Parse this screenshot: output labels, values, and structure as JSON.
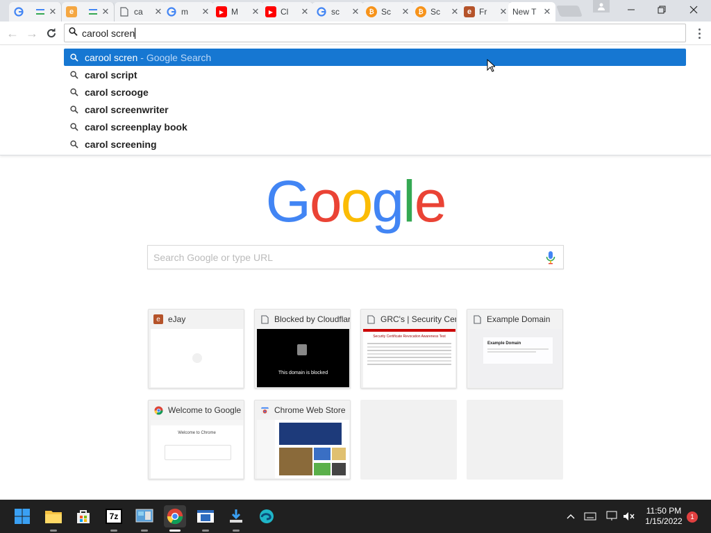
{
  "tabs": [
    {
      "title": "",
      "favicon": "google-icon",
      "close": "✕"
    },
    {
      "title": "",
      "favicon": "ejay-icon",
      "close": "✕"
    },
    {
      "title": "ca",
      "favicon": "page-icon",
      "close": "✕"
    },
    {
      "title": "m",
      "favicon": "google-icon",
      "close": "✕"
    },
    {
      "title": "M",
      "favicon": "youtube-icon",
      "close": "✕"
    },
    {
      "title": "Cl",
      "favicon": "youtube-icon",
      "close": "✕"
    },
    {
      "title": "sc",
      "favicon": "google-icon",
      "close": "✕"
    },
    {
      "title": "Sc",
      "favicon": "bitcoin-icon",
      "close": "✕"
    },
    {
      "title": "Sc",
      "favicon": "bitcoin-icon",
      "close": "✕"
    },
    {
      "title": "Fr",
      "favicon": "ejay-icon",
      "close": "✕"
    },
    {
      "title": "New T",
      "favicon": "",
      "close": "✕"
    }
  ],
  "omnibox": {
    "value": "carool scren"
  },
  "suggestions": [
    {
      "query": "carool scren",
      "desc": "- Google Search",
      "selected": true
    },
    {
      "query": "carol script",
      "desc": "",
      "selected": false
    },
    {
      "query": "carol scrooge",
      "desc": "",
      "selected": false
    },
    {
      "query": "carol screenwriter",
      "desc": "",
      "selected": false
    },
    {
      "query": "carol screenplay book",
      "desc": "",
      "selected": false
    },
    {
      "query": "carol screening",
      "desc": "",
      "selected": false
    }
  ],
  "ntp": {
    "search_placeholder": "Search Google or type URL",
    "tiles": [
      {
        "title": "eJay",
        "favicon": "ejay-icon",
        "thumb": "blank"
      },
      {
        "title": "Blocked by Cloudflare",
        "favicon": "page-icon",
        "thumb": "blocked",
        "thumb_text": "This domain is blocked"
      },
      {
        "title": "GRC's | Security Certi",
        "favicon": "page-icon",
        "thumb": "grc",
        "thumb_text": "Security Certificate Revocation Awareness Test"
      },
      {
        "title": "Example Domain",
        "favicon": "page-icon",
        "thumb": "example",
        "thumb_text": "Example Domain"
      },
      {
        "title": "Welcome to Google C",
        "favicon": "chrome-icon",
        "thumb": "welcome",
        "thumb_text": "Welcome to Chrome"
      },
      {
        "title": "Chrome Web Store",
        "favicon": "webstore-icon",
        "thumb": "store"
      },
      {
        "title": "",
        "favicon": "",
        "thumb": "empty"
      },
      {
        "title": "",
        "favicon": "",
        "thumb": "empty"
      }
    ]
  },
  "taskbar": {
    "apps": [
      "start-icon",
      "file-explorer-icon",
      "store-icon",
      "7zip-icon",
      "control-panel-icon",
      "chrome-icon",
      "app-window-icon",
      "downloader-icon",
      "edge-icon"
    ],
    "time": "11:50 PM",
    "date": "1/15/2022",
    "notifications": "1"
  },
  "colors": {
    "selected": "#1677d2",
    "tabstrip": "#dee1e6",
    "taskbar": "#202020"
  }
}
